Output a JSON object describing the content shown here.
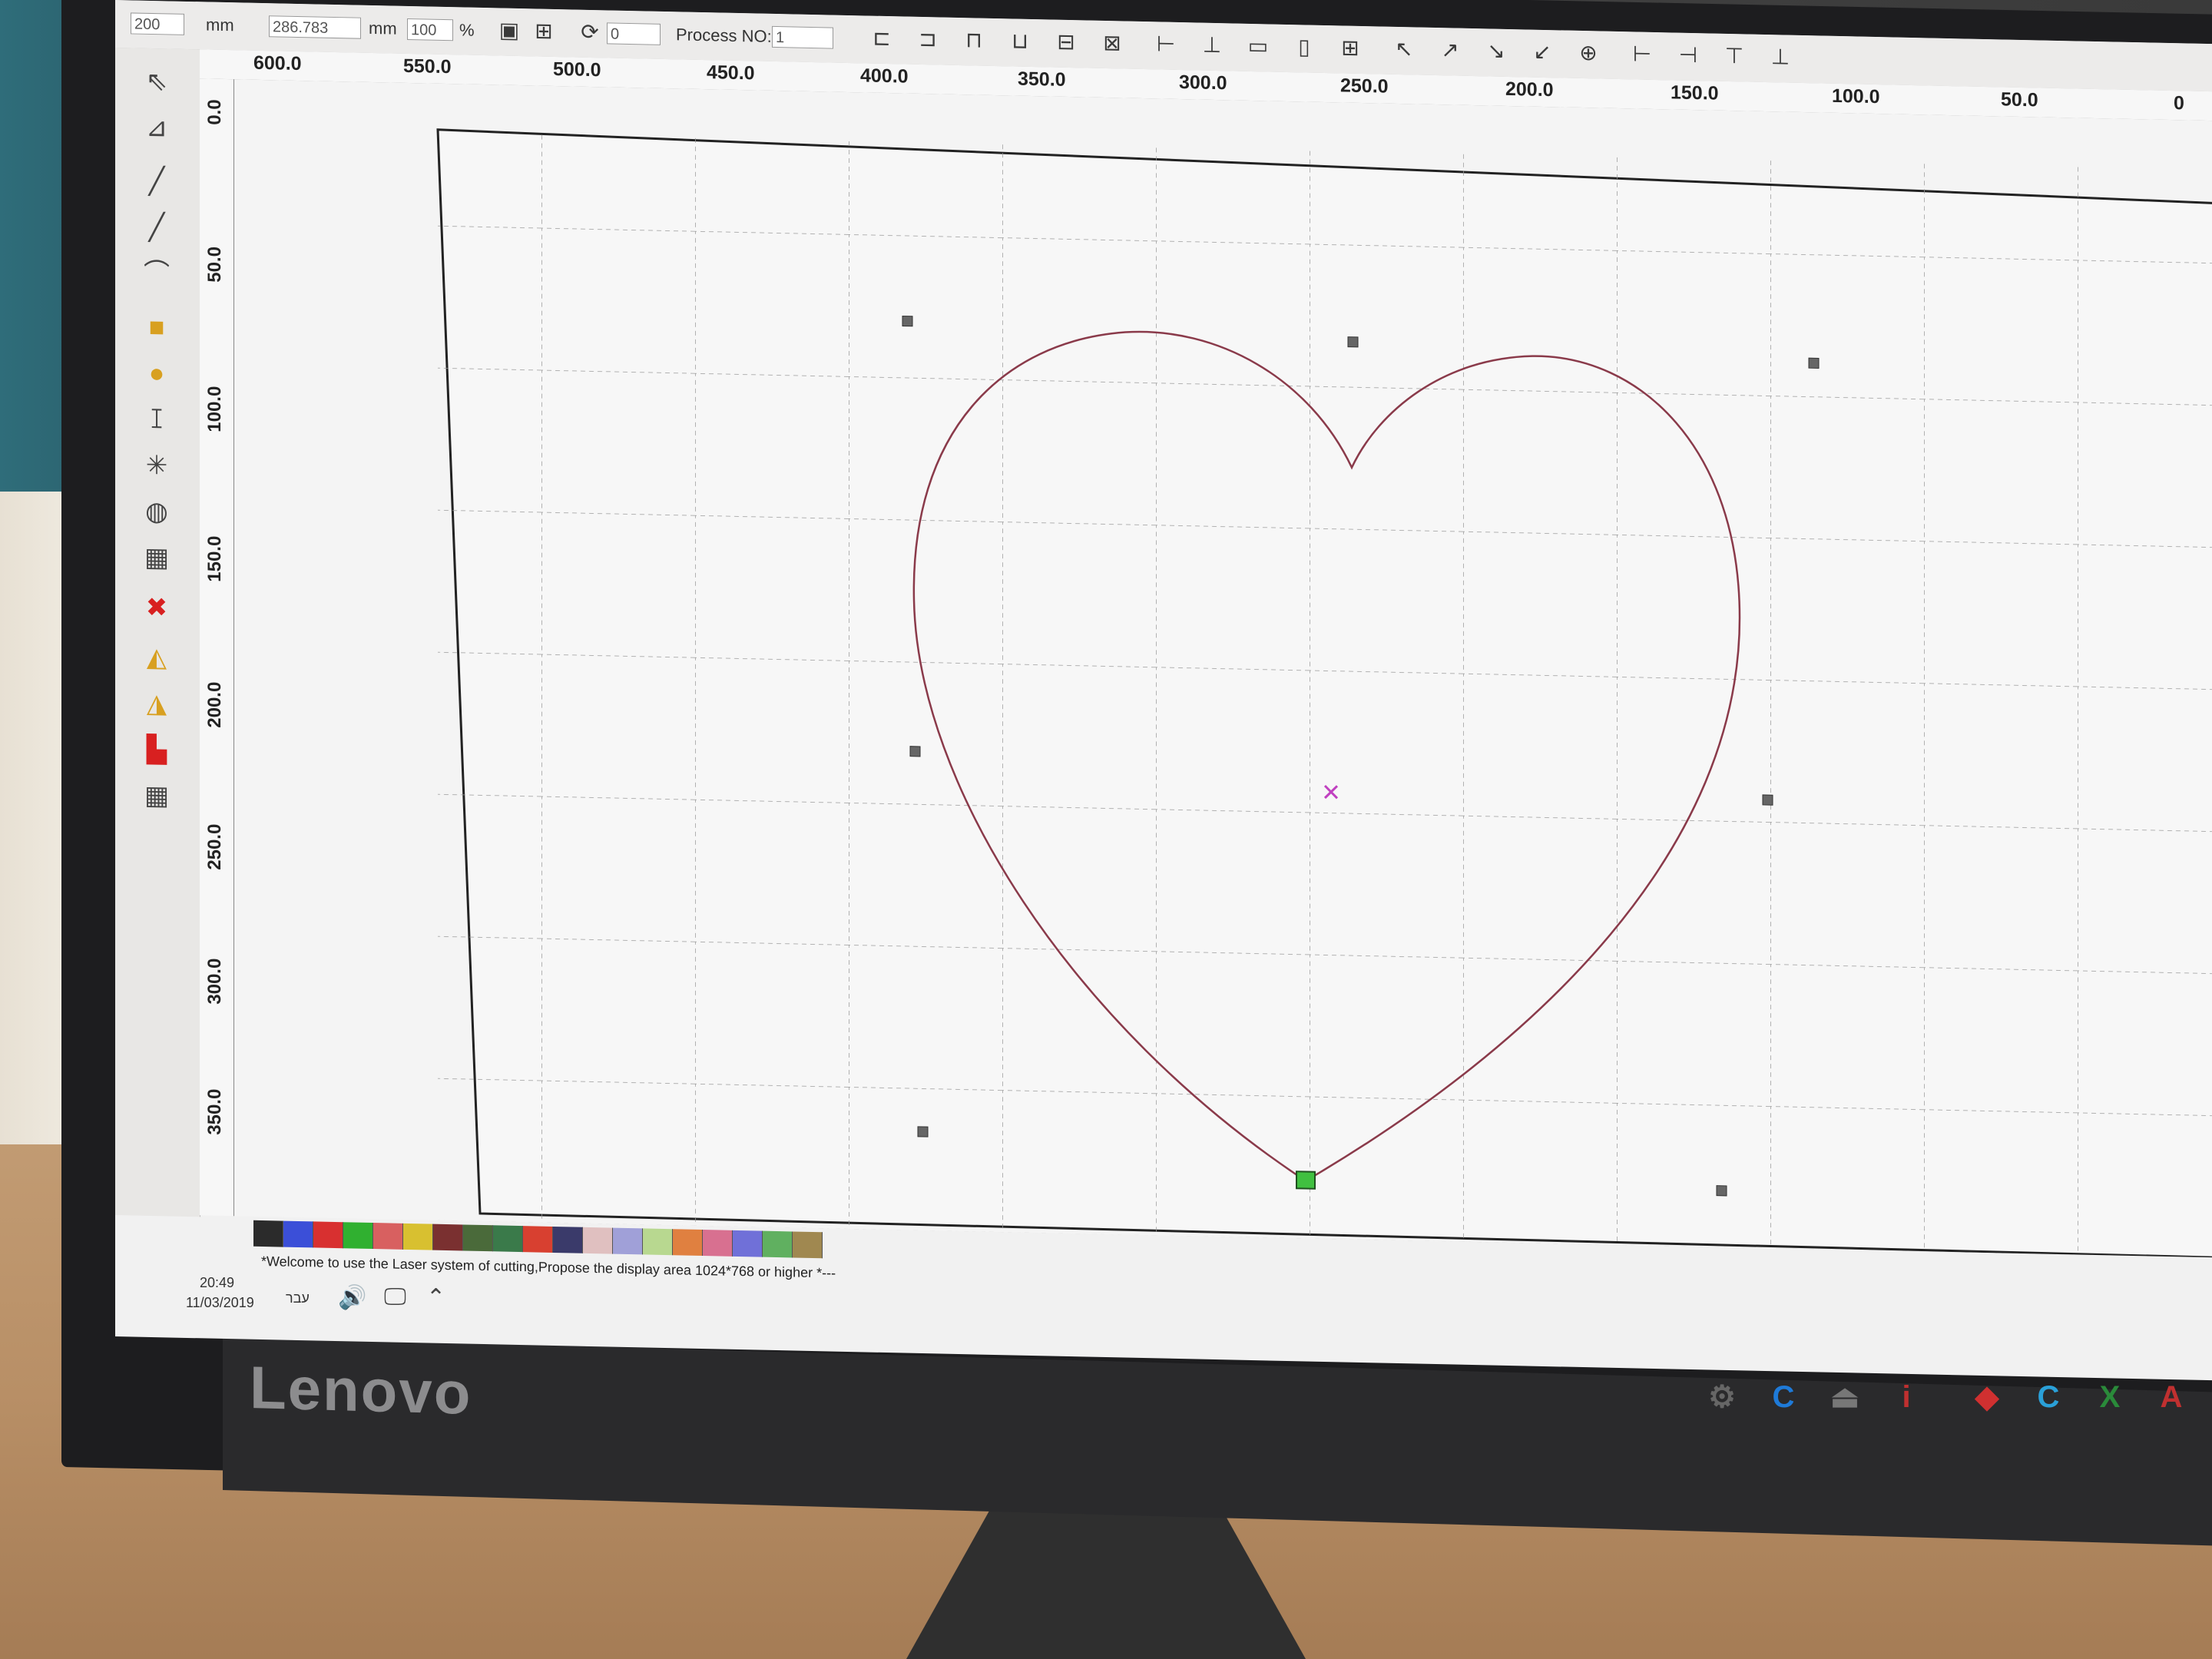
{
  "toolbar": {
    "x_value": "200",
    "x_unit": "mm",
    "y_value": "286.783",
    "y_unit": "mm",
    "scale_value": "100",
    "scale_unit": "%",
    "rotate_value": "0",
    "process_label": "Process NO:",
    "process_value": "1"
  },
  "ruler": {
    "horizontal": [
      "600.0",
      "550.0",
      "500.0",
      "450.0",
      "400.0",
      "350.0",
      "300.0",
      "250.0",
      "200.0",
      "150.0",
      "100.0",
      "50.0",
      "0"
    ],
    "vertical": [
      "0.0",
      "50.0",
      "100.0",
      "150.0",
      "200.0",
      "250.0",
      "300.0",
      "350.0"
    ]
  },
  "palette_colors": [
    "#2b2b2b",
    "#3b4fd8",
    "#d83030",
    "#30b030",
    "#d86060",
    "#d8c030",
    "#7a3030",
    "#4a6a3a",
    "#3a7a4a",
    "#d84030",
    "#3a3a6a",
    "#e0c0c0",
    "#a0a0d8",
    "#b8d890",
    "#e08040",
    "#d87090",
    "#7070d8",
    "#60b060",
    "#a08850"
  ],
  "status": {
    "message": "*Welcome to use the Laser system of cutting,Propose the display area 1024*768 or higher *---"
  },
  "tray": {
    "time": "20:49",
    "date": "11/03/2019",
    "language": "עבר"
  },
  "monitor": {
    "brand": "Lenovo"
  },
  "colors": {
    "heart_stroke": "#8a3a4a",
    "handle": "#666666",
    "center_mark": "#c040c0",
    "start_node": "#40c040"
  }
}
